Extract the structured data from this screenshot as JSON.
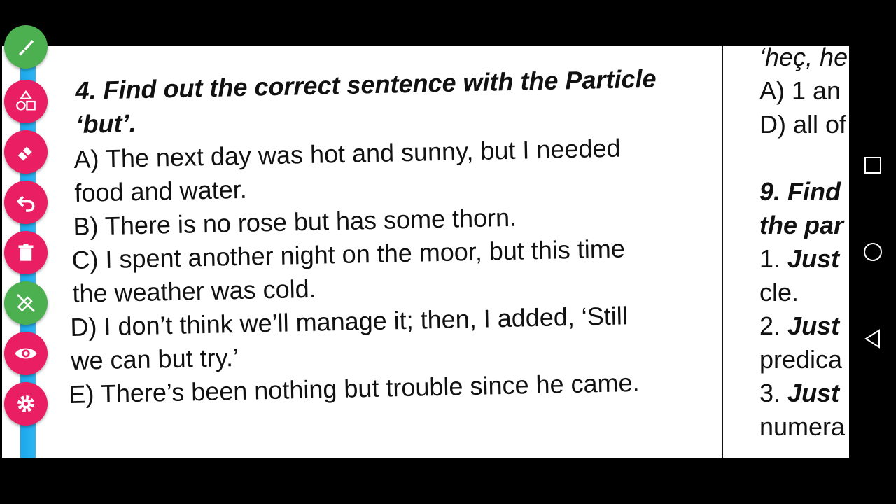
{
  "question": {
    "title_line1": "4. Find out the correct sentence with the Particle",
    "title_line2": "‘but’.",
    "options": [
      {
        "label": "A)",
        "line1": "The next day was hot and sunny, but I needed",
        "line2": "food and water."
      },
      {
        "label": "B)",
        "line1": "There is no rose but has some thorn.",
        "line2": ""
      },
      {
        "label": "C)",
        "line1": "I spent another night on the moor, but this time",
        "line2": "the weather was cold."
      },
      {
        "label": "D)",
        "line1": "I don’t think we’ll manage it; then, I added, ‘Still",
        "line2": "we can but try.’"
      },
      {
        "label": "E)",
        "line1": "There’s been nothing but trouble since he came.",
        "line2": ""
      }
    ]
  },
  "right_column": {
    "lines": [
      {
        "text": "‘heç, he",
        "style": "italic"
      },
      {
        "text": "A) 1 an",
        "style": "normal"
      },
      {
        "text": "D) all of",
        "style": "normal"
      },
      {
        "text": "",
        "style": "normal"
      },
      {
        "text": "9. Find",
        "style": "bold-italic"
      },
      {
        "text": "the par",
        "style": "bold-italic"
      },
      {
        "num": "1.",
        "bold": "Just",
        "style": "mixed"
      },
      {
        "text": "cle.",
        "style": "normal"
      },
      {
        "num": "2.",
        "bold": "Just",
        "style": "mixed"
      },
      {
        "text": "predica",
        "style": "normal"
      },
      {
        "num": "3.",
        "bold": "Just",
        "style": "mixed"
      },
      {
        "text": "numera",
        "style": "normal"
      }
    ]
  },
  "toolbar": {
    "tools": [
      "brush-icon",
      "shapes-icon",
      "eraser-icon",
      "undo-icon",
      "delete-icon",
      "hide-drawings-icon",
      "eye-icon",
      "settings-icon"
    ]
  },
  "navbar": {
    "buttons": [
      "recents-button",
      "home-button",
      "back-button"
    ]
  },
  "colors": {
    "tool_pink": "#e91e63",
    "tool_green": "#4caf50",
    "strip_blue": "#1aa7ec"
  }
}
